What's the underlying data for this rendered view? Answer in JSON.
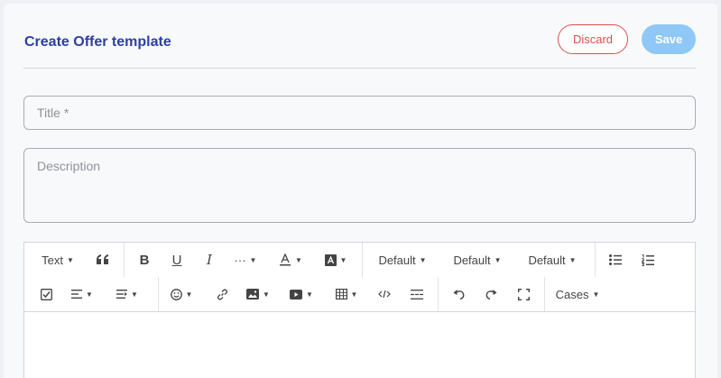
{
  "header": {
    "title": "Create Offer template",
    "discard_label": "Discard",
    "save_label": "Save"
  },
  "form": {
    "title_placeholder": "Title *",
    "description_placeholder": "Description"
  },
  "toolbar": {
    "text_label": "Text",
    "more_label": "···",
    "font_family_label": "Default",
    "font_size_label": "Default",
    "line_height_label": "Default",
    "cases_label": "Cases"
  },
  "colors": {
    "title": "#2d3f9e",
    "discard": "#e14c4c",
    "save": "#8fc8f6"
  }
}
